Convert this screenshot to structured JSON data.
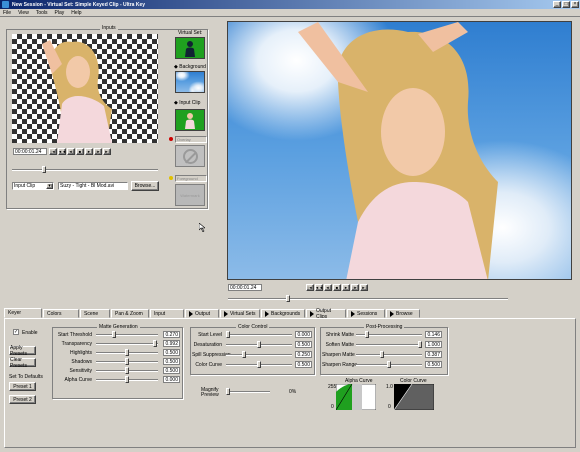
{
  "window": {
    "title": "New Session - Virtual Set: Simple Keyed Clip - Ultra Key"
  },
  "menu": [
    "File",
    "View",
    "Tools",
    "Play",
    "Help"
  ],
  "inputs": {
    "title": "Inputs",
    "timecode": "00:00:01.24",
    "source_select": "Input Clip",
    "source_file": "Suzy - Tight - Bl Mod.avi",
    "browse_label": "Browse...",
    "virtual_set_label": "Virtual Set:",
    "background_label": "Background",
    "input_clip_label": "Input Clip",
    "overlay_label": "Overlay",
    "overlay_select": "Overlay",
    "foreground_label": "Foreground",
    "foreground_select": "Foreground",
    "watermark_label": "Watermark",
    "transport": [
      "|◄",
      "◄◄",
      "◄|",
      "■",
      "►",
      "|►",
      "►|"
    ]
  },
  "preview": {
    "timecode": "00:00:01.24",
    "transport": [
      "|◄",
      "◄◄",
      "◄|",
      "■",
      "►",
      "|►",
      "►|"
    ]
  },
  "tabs": [
    "Keyer",
    "Colors",
    "Scene",
    "Pan & Zoom",
    "Input",
    "Output",
    "Virtual Sets",
    "Backgrounds",
    "Output Clips",
    "Sessions",
    "Browse"
  ],
  "keyer": {
    "enable_label": "Enable",
    "apply_presets": "Apply Presets",
    "clear_presets": "Clear Presets",
    "set_defaults": "Set To Defaults",
    "preset1": "Preset 1",
    "preset2": "Preset 2",
    "matte_gen": {
      "title": "Matte Generation",
      "rows": [
        {
          "label": "Start Threshold",
          "value": "0.270",
          "pos": 0.27
        },
        {
          "label": "Transparency",
          "value": "0.992",
          "pos": 0.99
        },
        {
          "label": "Highlights",
          "value": "0.500",
          "pos": 0.5
        },
        {
          "label": "Shadows",
          "value": "0.500",
          "pos": 0.5
        },
        {
          "label": "Sensitivity",
          "value": "0.500",
          "pos": 0.5
        },
        {
          "label": "Alpha Curve",
          "value": "0.000",
          "pos": 0.5
        }
      ]
    },
    "color_ctl": {
      "title": "Color Control",
      "rows": [
        {
          "label": "Start Level",
          "value": "0.000",
          "pos": 0.0
        },
        {
          "label": "Desaturation",
          "value": "0.500",
          "pos": 0.5
        },
        {
          "label": "Spill Suppression",
          "value": "0.250",
          "pos": 0.25
        },
        {
          "label": "Color Curve",
          "value": "0.500",
          "pos": 0.5
        }
      ]
    },
    "magnify": {
      "label": "Magnify Preview",
      "value": "0%"
    },
    "post": {
      "title": "Post-Processing",
      "rows": [
        {
          "label": "Shrink Matte",
          "value": "0.146",
          "pos": 0.15
        },
        {
          "label": "Soften Matte",
          "value": "1.000",
          "pos": 1.0
        },
        {
          "label": "Sharpen Matte",
          "value": "0.387",
          "pos": 0.39
        },
        {
          "label": "Sharpen Range",
          "value": "0.500",
          "pos": 0.5
        }
      ]
    },
    "alpha_curve": {
      "title": "Alpha Curve",
      "y_top": "255",
      "y_bottom": "0"
    },
    "color_curve": {
      "title": "Color Curve",
      "y_top": "1.0",
      "y_bottom": "0"
    }
  },
  "colors": {
    "title_bar": "#0a246a",
    "green": "#1fa01f",
    "sky": "#4a90d9"
  }
}
